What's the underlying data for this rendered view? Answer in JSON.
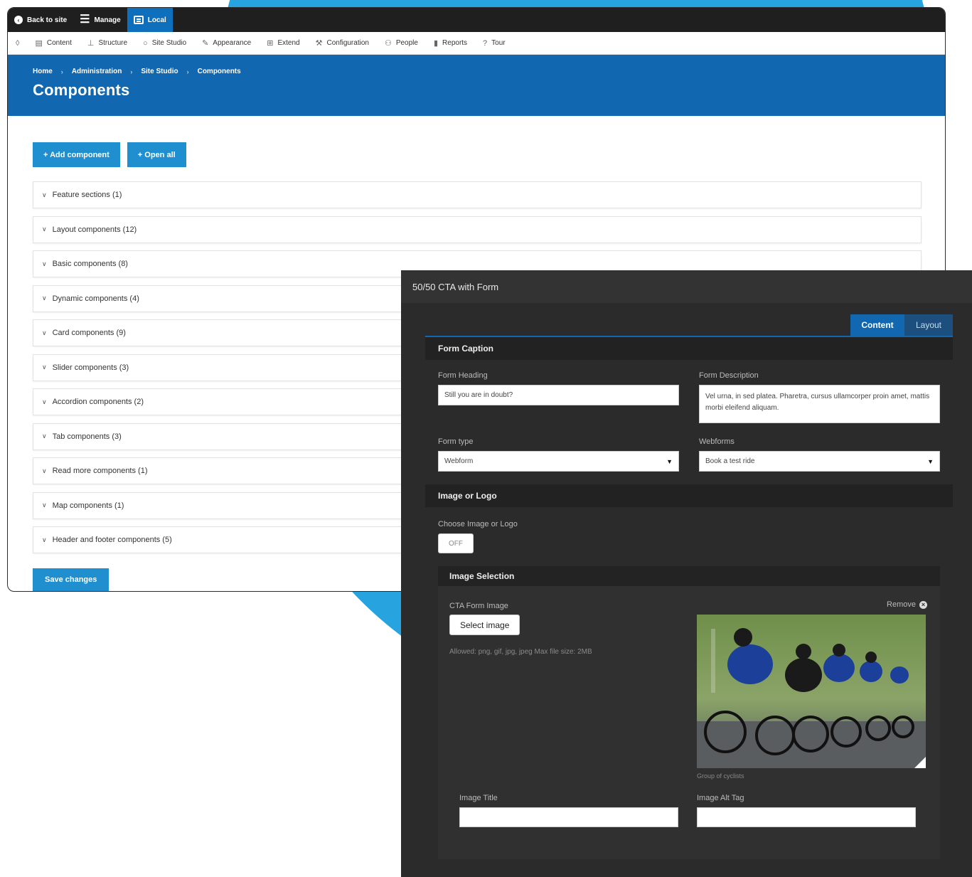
{
  "admin": {
    "toolbar": {
      "back_label": "Back to site",
      "manage_label": "Manage",
      "local_label": "Local"
    },
    "menu": [
      {
        "icon": "content-icon",
        "label": "Content"
      },
      {
        "icon": "structure-icon",
        "label": "Structure"
      },
      {
        "icon": "site-studio-icon",
        "label": "Site Studio"
      },
      {
        "icon": "appearance-icon",
        "label": "Appearance"
      },
      {
        "icon": "extend-icon",
        "label": "Extend"
      },
      {
        "icon": "configuration-icon",
        "label": "Configuration"
      },
      {
        "icon": "people-icon",
        "label": "People"
      },
      {
        "icon": "reports-icon",
        "label": "Reports"
      },
      {
        "icon": "tour-icon",
        "label": "Tour"
      }
    ],
    "breadcrumb": [
      "Home",
      "Administration",
      "Site Studio",
      "Components"
    ],
    "page_title": "Components",
    "add_component": "+ Add component",
    "open_all": "+ Open all",
    "accordions": [
      "Feature sections (1)",
      "Layout components (12)",
      "Basic components (8)",
      "Dynamic components (4)",
      "Card components (9)",
      "Slider components (3)",
      "Accordion components (2)",
      "Tab components (3)",
      "Read more components (1)",
      "Map components (1)",
      "Header and footer components (5)"
    ],
    "save_changes": "Save changes"
  },
  "panel": {
    "title": "50/50 CTA with Form",
    "tabs": [
      "Content",
      "Layout"
    ],
    "form_caption": {
      "heading": "Form Caption",
      "form_heading_label": "Form Heading",
      "form_heading_value": "Still you are in doubt?",
      "form_description_label": "Form Description",
      "form_description_value": "Vel urna, in sed platea. Pharetra, cursus ullamcorper proin amet, mattis morbi eleifend aliquam.",
      "form_type_label": "Form type",
      "form_type_value": "Webform",
      "webforms_label": "Webforms",
      "webforms_value": "Book a test ride"
    },
    "image_logo": {
      "heading": "Image or Logo",
      "choose_label": "Choose Image or Logo",
      "toggle": "OFF"
    },
    "image_selection": {
      "heading": "Image Selection",
      "cta_image_label": "CTA Form Image",
      "select_button": "Select image",
      "allowed": "Allowed: png, gif, jpg, jpeg Max file size: 2MB",
      "remove": "Remove",
      "image_caption": "Group of cyclists",
      "image_title_label": "Image Title",
      "image_alt_label": "Image Alt Tag"
    }
  },
  "colors": {
    "admin_blue": "#1267b1",
    "button_blue": "#1f8fd0",
    "background_circle": "#27a4e0",
    "panel_dark": "#2b2b2b"
  }
}
